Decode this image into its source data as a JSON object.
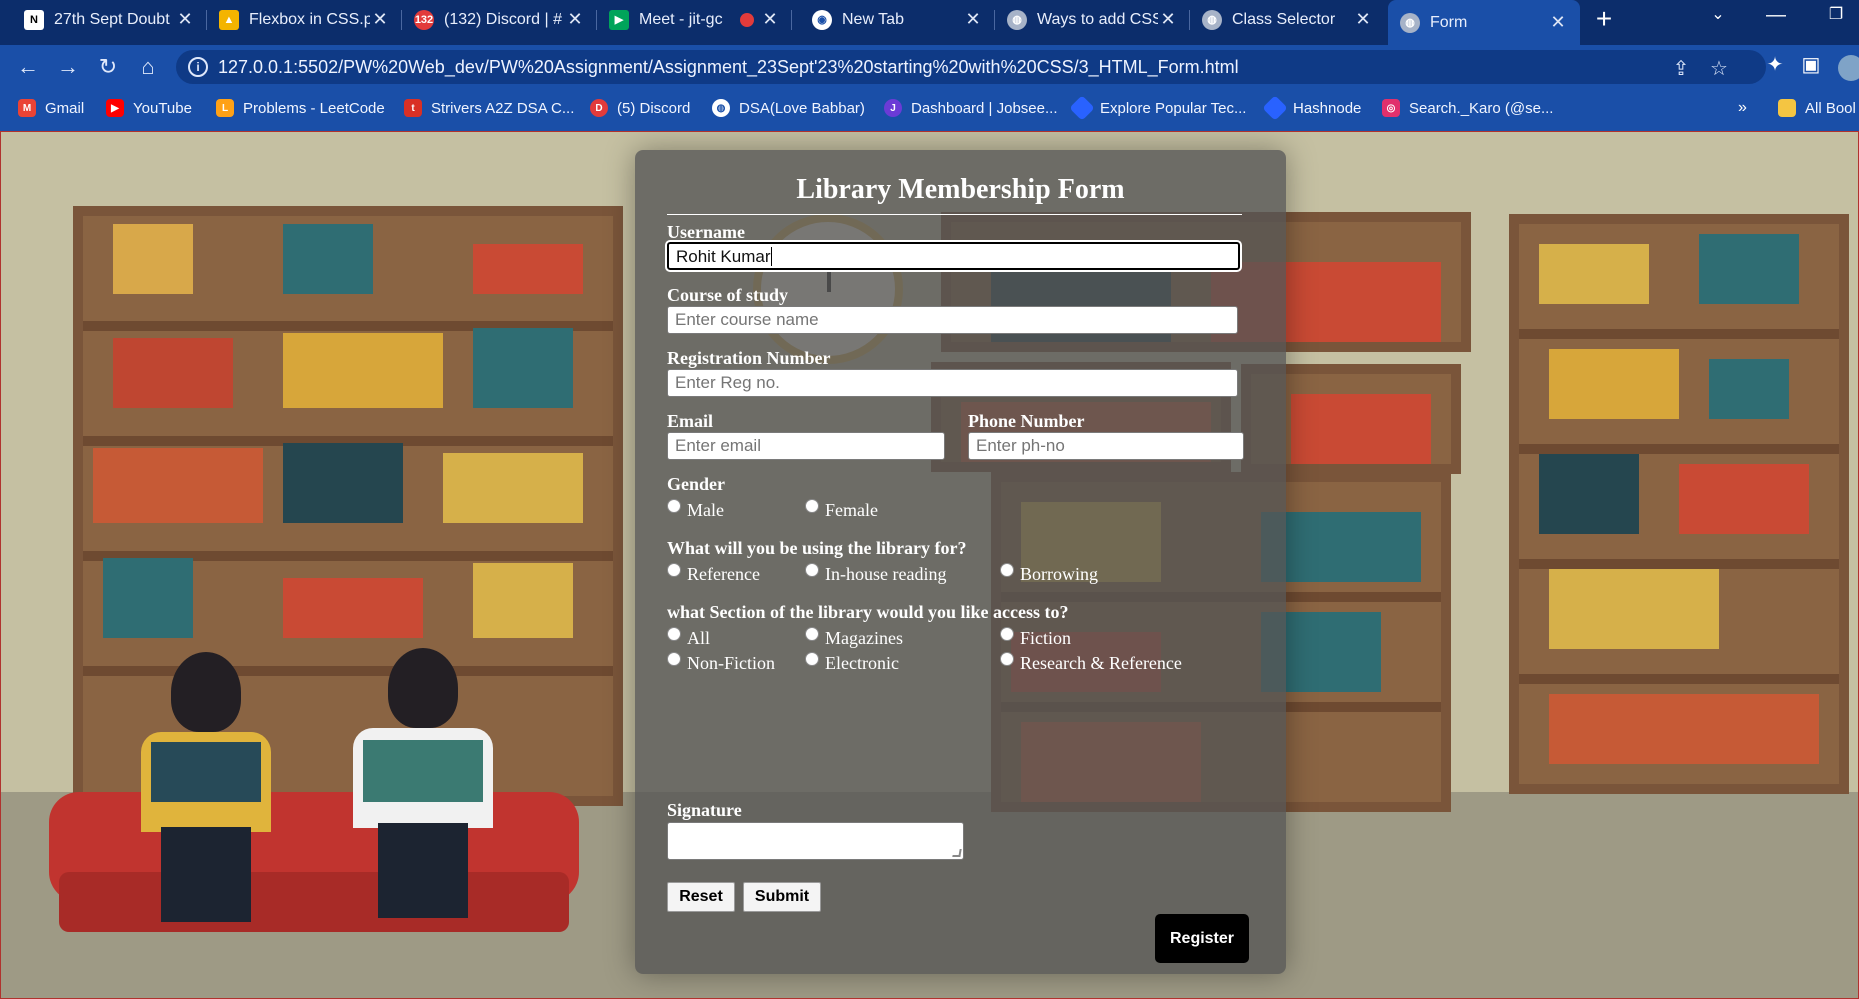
{
  "tabs": [
    {
      "title": "27th Sept Doubt",
      "icon": "notion-icon",
      "color": "#ffffff"
    },
    {
      "title": "Flexbox in CSS.p",
      "icon": "google-drive-icon",
      "color": "#f4b400"
    },
    {
      "title": "(132) Discord | #",
      "icon": "discord-icon",
      "color": "#e23b3b"
    },
    {
      "title": "Meet - jit-gc",
      "icon": "google-meet-icon",
      "color": "#00a45a"
    },
    {
      "title": "New Tab",
      "icon": "chrome-icon",
      "color": "#ffffff"
    },
    {
      "title": "Ways to add CSS",
      "icon": "globe-icon",
      "color": "#a7b3c8"
    },
    {
      "title": "Class Selector",
      "icon": "globe-icon",
      "color": "#a7b3c8"
    },
    {
      "title": "Form",
      "icon": "globe-icon",
      "color": "#a7b3c8",
      "active": true
    }
  ],
  "address": {
    "url": "127.0.0.1:5502/PW%20Web_dev/PW%20Assignment/Assignment_23Sept'23%20starting%20with%20CSS/3_HTML_Form.html"
  },
  "bookmarks": [
    {
      "label": "Gmail",
      "icon": "gmail-icon",
      "color": "#ea4335"
    },
    {
      "label": "YouTube",
      "icon": "youtube-icon",
      "color": "#ff0000"
    },
    {
      "label": "Problems - LeetCode",
      "icon": "leetcode-icon",
      "color": "#ffa116"
    },
    {
      "label": "Strivers A2Z DSA C...",
      "icon": "tuf-icon",
      "color": "#d93025"
    },
    {
      "label": "(5) Discord",
      "icon": "discord-icon",
      "color": "#e23b3b"
    },
    {
      "label": "DSA(Love Babbar)",
      "icon": "globe-icon",
      "color": "#ffffff"
    },
    {
      "label": "Dashboard | Jobsee...",
      "icon": "jobseeker-icon",
      "color": "#6b3bd6"
    },
    {
      "label": "Explore Popular Tec...",
      "icon": "hashnode-icon",
      "color": "#2962ff"
    },
    {
      "label": "Hashnode",
      "icon": "hashnode-icon",
      "color": "#2962ff"
    },
    {
      "label": "Search._Karo (@se...",
      "icon": "instagram-icon",
      "color": "#e1306c"
    }
  ],
  "bookmarks_overflow": "»",
  "all_bookmarks": "All Bool",
  "form": {
    "title": "Library Membership Form",
    "username_label": "Username",
    "username_value": "Rohit Kumar",
    "course_label": "Course of study",
    "course_placeholder": "Enter course name",
    "reg_label": "Registration Number",
    "reg_placeholder": "Enter Reg no.",
    "email_label": "Email",
    "email_placeholder": "Enter email",
    "phone_label": "Phone Number",
    "phone_placeholder": "Enter ph-no",
    "gender_label": "Gender",
    "gender_options": [
      "Male",
      "Female"
    ],
    "usage_label": "What will you be using the library for?",
    "usage_options": [
      "Reference",
      "In-house reading",
      "Borrowing"
    ],
    "section_label": "what Section of the library would you like access to?",
    "section_options": [
      "All",
      "Magazines",
      "Fiction",
      "Non-Fiction",
      "Electronic",
      "Research & Reference"
    ],
    "signature_label": "Signature",
    "reset_label": "Reset",
    "submit_label": "Submit",
    "register_label": "Register"
  }
}
